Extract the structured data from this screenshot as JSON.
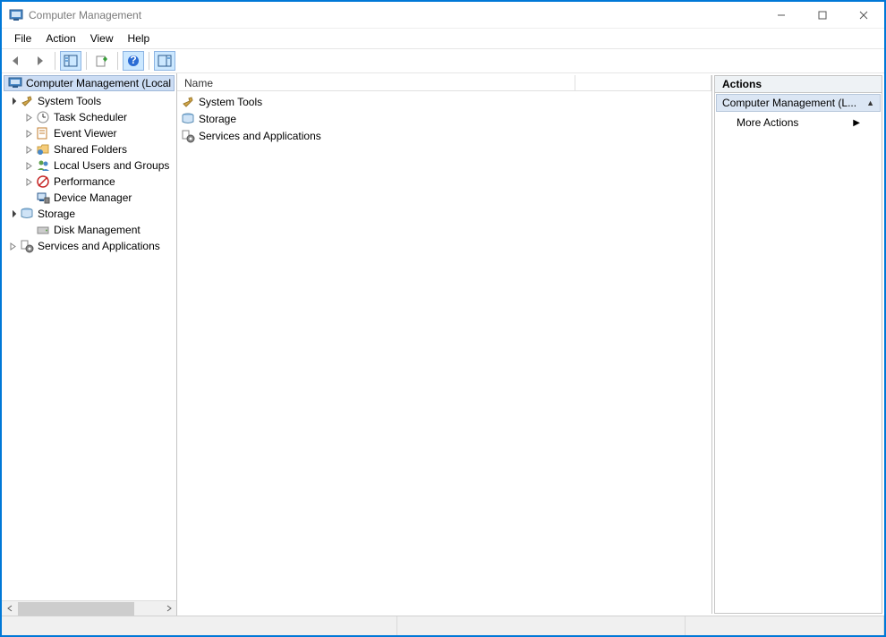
{
  "window": {
    "title": "Computer Management"
  },
  "menu": {
    "file": "File",
    "action": "Action",
    "view": "View",
    "help": "Help"
  },
  "tree": {
    "root": "Computer Management (Local",
    "system_tools": "System Tools",
    "task_scheduler": "Task Scheduler",
    "event_viewer": "Event Viewer",
    "shared_folders": "Shared Folders",
    "local_users": "Local Users and Groups",
    "performance": "Performance",
    "device_manager": "Device Manager",
    "storage": "Storage",
    "disk_management": "Disk Management",
    "services_apps": "Services and Applications"
  },
  "content": {
    "col_name": "Name",
    "rows": {
      "system_tools": "System Tools",
      "storage": "Storage",
      "services_apps": "Services and Applications"
    }
  },
  "actions": {
    "title": "Actions",
    "section": "Computer Management (L...",
    "more": "More Actions"
  }
}
